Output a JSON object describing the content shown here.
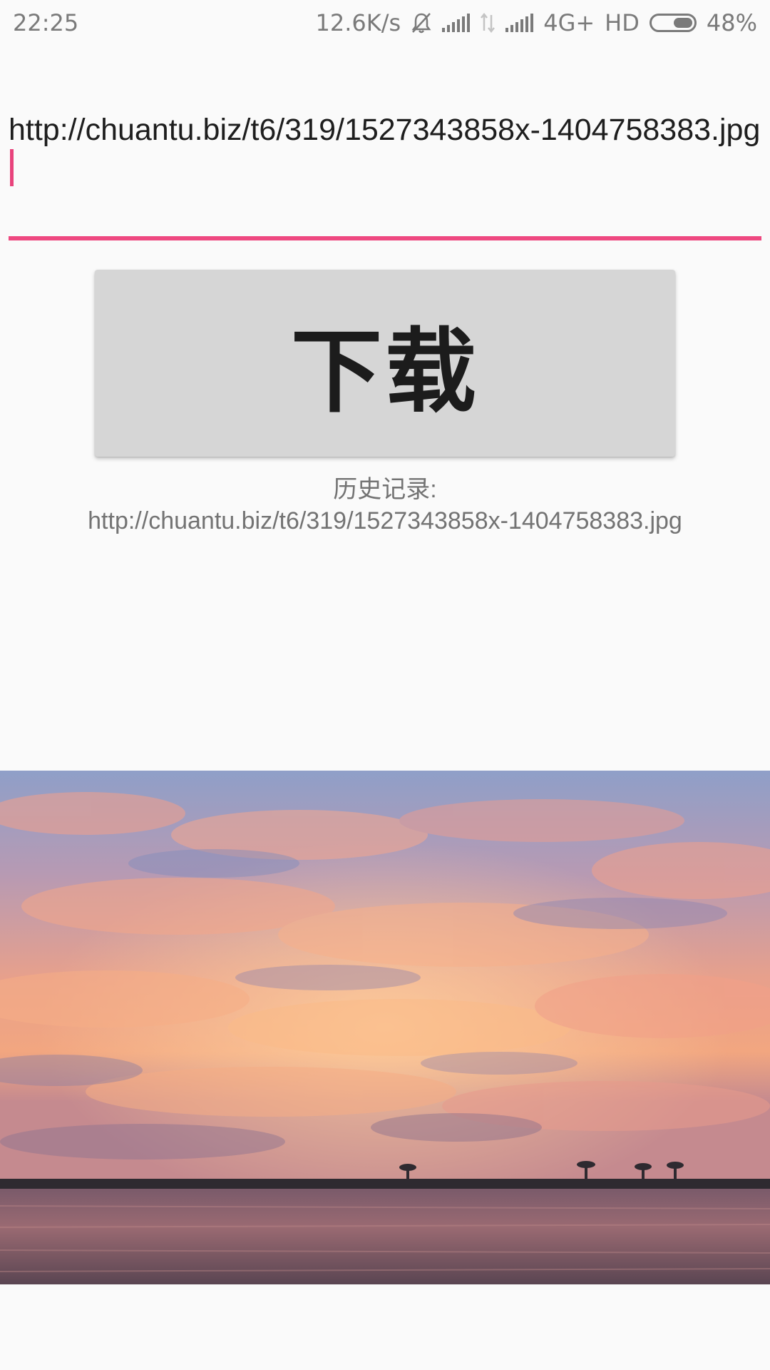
{
  "status_bar": {
    "time": "22:25",
    "net_speed": "12.6K/s",
    "network": "4G+",
    "hd": "HD",
    "battery_percent": "48%",
    "battery_level": 0.48,
    "icons": [
      "mute-bell-icon",
      "signal-icon",
      "data-arrows-icon",
      "signal-icon",
      "battery-icon"
    ]
  },
  "url_input": {
    "value": "http://chuantu.biz/t6/319/1527343858x-1404758383.jpg",
    "accent_color": "#ee4880"
  },
  "download_button": {
    "label": "下载"
  },
  "history": {
    "label": "历史记录:",
    "url": "http://chuantu.biz/t6/319/1527343858x-1404758383.jpg"
  },
  "image": {
    "icon": "sunset-photo"
  }
}
